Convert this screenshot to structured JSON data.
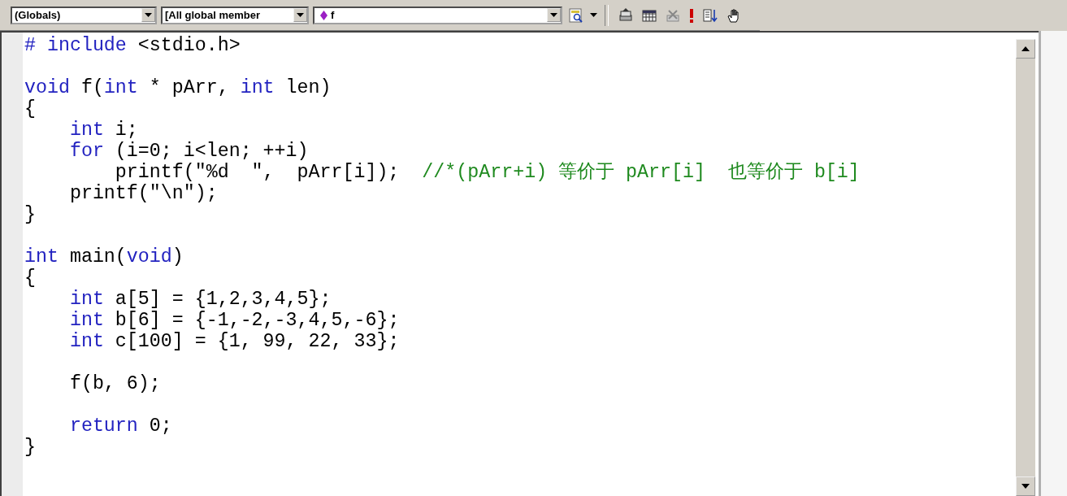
{
  "toolbar": {
    "combos": [
      {
        "value": "(Globals)",
        "kind": "plain"
      },
      {
        "value": "[All global member",
        "kind": "plain"
      },
      {
        "value": "f",
        "kind": "function"
      }
    ]
  },
  "editor": {
    "lines": [
      {
        "kind": "code",
        "tokens": [
          {
            "text": "# include",
            "kind": "keyword"
          },
          {
            "text": " <stdio.h>",
            "kind": "plain"
          }
        ]
      },
      {
        "kind": "blank"
      },
      {
        "kind": "code",
        "tokens": [
          {
            "text": "void",
            "kind": "keyword"
          },
          {
            "text": " f(",
            "kind": "plain"
          },
          {
            "text": "int",
            "kind": "keyword"
          },
          {
            "text": " * pArr, ",
            "kind": "plain"
          },
          {
            "text": "int",
            "kind": "keyword"
          },
          {
            "text": " len)",
            "kind": "plain"
          }
        ]
      },
      {
        "kind": "code",
        "tokens": [
          {
            "text": "{",
            "kind": "plain"
          }
        ]
      },
      {
        "kind": "code",
        "tokens": [
          {
            "text": "    int",
            "kind": "keyword"
          },
          {
            "text": " i;",
            "kind": "plain"
          }
        ]
      },
      {
        "kind": "code",
        "tokens": [
          {
            "text": "    for",
            "kind": "keyword"
          },
          {
            "text": " (i=0; i<len; ++i)",
            "kind": "plain"
          }
        ]
      },
      {
        "kind": "code",
        "tokens": [
          {
            "text": "        printf(\"%d  \",  pArr[i]);  ",
            "kind": "plain"
          },
          {
            "text": "//*(pArr+i) 等价于 pArr[i]  也等价于 b[i]",
            "kind": "comment"
          }
        ]
      },
      {
        "kind": "code",
        "tokens": [
          {
            "text": "    printf(\"\\n\");",
            "kind": "plain"
          }
        ]
      },
      {
        "kind": "code",
        "tokens": [
          {
            "text": "}",
            "kind": "plain"
          }
        ]
      },
      {
        "kind": "blank"
      },
      {
        "kind": "code",
        "tokens": [
          {
            "text": "int",
            "kind": "keyword"
          },
          {
            "text": " main(",
            "kind": "plain"
          },
          {
            "text": "void",
            "kind": "keyword"
          },
          {
            "text": ")",
            "kind": "plain"
          }
        ]
      },
      {
        "kind": "code",
        "tokens": [
          {
            "text": "{",
            "kind": "plain"
          }
        ]
      },
      {
        "kind": "code",
        "tokens": [
          {
            "text": "    int",
            "kind": "keyword"
          },
          {
            "text": " a[5] = {1,2,3,4,5};",
            "kind": "plain"
          }
        ]
      },
      {
        "kind": "code",
        "tokens": [
          {
            "text": "    int",
            "kind": "keyword"
          },
          {
            "text": " b[6] = {-1,-2,-3,4,5,-6};",
            "kind": "plain"
          }
        ]
      },
      {
        "kind": "code",
        "tokens": [
          {
            "text": "    int",
            "kind": "keyword"
          },
          {
            "text": " c[100] = {1, 99, 22, 33};",
            "kind": "plain"
          }
        ]
      },
      {
        "kind": "blank"
      },
      {
        "kind": "code",
        "tokens": [
          {
            "text": "    f(b, 6);",
            "kind": "plain"
          }
        ]
      },
      {
        "kind": "blank"
      },
      {
        "kind": "code",
        "tokens": [
          {
            "text": "    return",
            "kind": "keyword"
          },
          {
            "text": " 0;",
            "kind": "plain"
          }
        ]
      },
      {
        "kind": "code",
        "tokens": [
          {
            "text": "}",
            "kind": "plain"
          }
        ]
      }
    ]
  }
}
